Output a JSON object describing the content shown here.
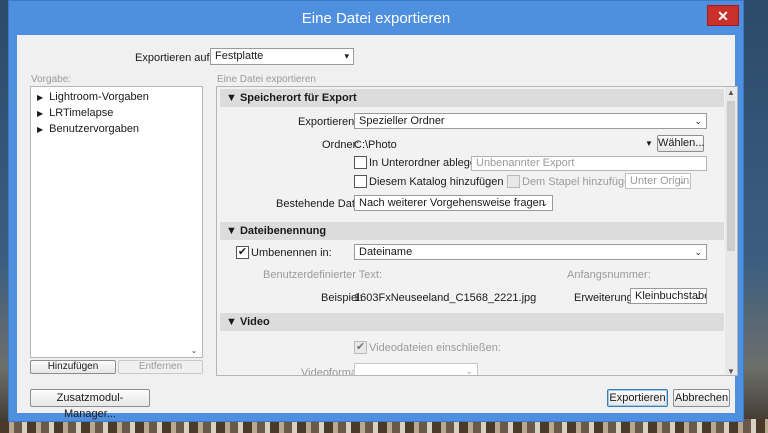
{
  "window": {
    "title": "Eine Datei exportieren",
    "close_glyph": "✕"
  },
  "export_to": {
    "label": "Exportieren auf:",
    "value": "Festplatte"
  },
  "presets": {
    "label": "Vorgabe:",
    "items": [
      {
        "label": "Lightroom-Vorgaben"
      },
      {
        "label": "LRTimelapse"
      },
      {
        "label": "Benutzervorgaben"
      }
    ],
    "add_label": "Hinzufügen",
    "remove_label": "Entfernen"
  },
  "panel": {
    "label": "Eine Datei exportieren",
    "location": {
      "title": "Speicherort für Export",
      "export_in_label": "Exportieren in:",
      "export_in_value": "Spezieller Ordner",
      "folder_label": "Ordner:",
      "folder_value": "C:\\Photo",
      "choose_label": "Wählen...",
      "subfolder_label": "In Unterordner ablegen:",
      "subfolder_placeholder": "Unbenannter Export",
      "catalog_label": "Diesem Katalog hinzufügen",
      "stack_label": "Dem Stapel hinzufügen:",
      "stack_value": "Unter Origina",
      "existing_label": "Bestehende Dateien:",
      "existing_value": "Nach weiterer Vorgehensweise fragen"
    },
    "naming": {
      "title": "Dateibenennung",
      "rename_label": "Umbenennen in:",
      "rename_value": "Dateiname",
      "custom_text_label": "Benutzerdefinierter Text:",
      "start_number_label": "Anfangsnummer:",
      "example_label": "Beispiel:",
      "example_value": "1603FxNeuseeland_C1568_2221.jpg",
      "extensions_label": "Erweiterungen:",
      "extensions_value": "Kleinbuchstaben"
    },
    "video": {
      "title": "Video",
      "include_label": "Videodateien einschließen:",
      "format_label": "Videoformat:"
    }
  },
  "footer": {
    "plugin_manager_label": "Zusatzmodul-Manager...",
    "export_label": "Exportieren",
    "cancel_label": "Abbrechen"
  }
}
